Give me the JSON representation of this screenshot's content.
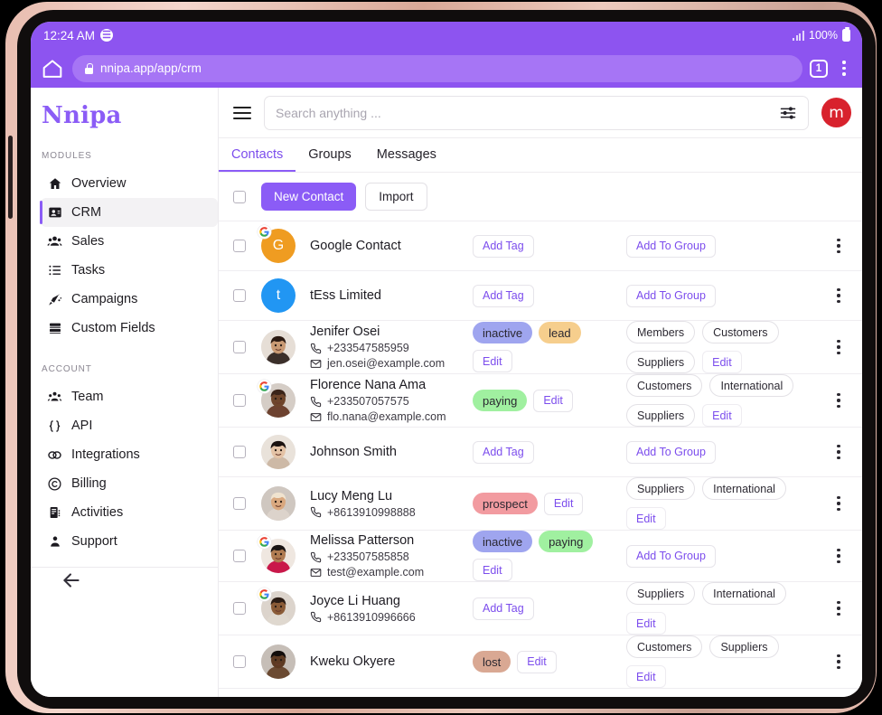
{
  "device": {
    "status_bar": {
      "time": "12:24 AM",
      "app_indicator_icon": "spotify-icon",
      "signal_icon": "signal-bars-icon",
      "battery_percent": "100%",
      "battery_icon": "battery-full-icon"
    },
    "browser": {
      "home_icon": "home-icon",
      "lock_icon": "lock-icon",
      "url": "nnipa.app/app/crm",
      "tab_count": "1",
      "menu_icon": "overflow-menu-icon"
    }
  },
  "sidebar": {
    "brand": "Nnipa",
    "sections": [
      {
        "label": "MODULES",
        "items": [
          {
            "label": "Overview",
            "icon": "home-icon",
            "active": false
          },
          {
            "label": "CRM",
            "icon": "contact-card-icon",
            "active": true
          },
          {
            "label": "Sales",
            "icon": "people-group-icon",
            "active": false
          },
          {
            "label": "Tasks",
            "icon": "task-list-icon",
            "active": false
          },
          {
            "label": "Campaigns",
            "icon": "megaphone-icon",
            "active": false
          },
          {
            "label": "Custom Fields",
            "icon": "layers-icon",
            "active": false
          }
        ]
      },
      {
        "label": "ACCOUNT",
        "items": [
          {
            "label": "Team",
            "icon": "team-icon",
            "active": false
          },
          {
            "label": "API",
            "icon": "braces-icon",
            "active": false
          },
          {
            "label": "Integrations",
            "icon": "link-icon",
            "active": false
          },
          {
            "label": "Billing",
            "icon": "coin-icon",
            "active": false
          },
          {
            "label": "Activities",
            "icon": "activity-icon",
            "active": false
          },
          {
            "label": "Support",
            "icon": "support-agent-icon",
            "active": false
          }
        ]
      }
    ],
    "back_icon": "arrow-left-icon"
  },
  "topbar": {
    "menu_icon": "hamburger-icon",
    "search_placeholder": "Search anything ...",
    "search_value": "",
    "filter_icon": "filter-sliders-icon",
    "avatar_initial": "m",
    "avatar_color": "#d8222d"
  },
  "tabs": [
    {
      "label": "Contacts",
      "active": true
    },
    {
      "label": "Groups",
      "active": false
    },
    {
      "label": "Messages",
      "active": false
    }
  ],
  "actions": {
    "new_contact_label": "New Contact",
    "import_label": "Import",
    "primary_color": "#8b5cf6"
  },
  "labels": {
    "add_tag": "Add Tag",
    "add_to_group": "Add To Group",
    "edit": "Edit"
  },
  "tag_colors": {
    "inactive": "#9fa5ef",
    "lead": "#f6ce8d",
    "paying": "#a0f0a0",
    "prospect": "#f29ba0",
    "lost": "#d9a893"
  },
  "contacts": [
    {
      "name": "Google Contact",
      "phone": "",
      "email": "",
      "avatar_type": "initial",
      "avatar_initial": "G",
      "avatar_color": "#ef9c21",
      "google_badge": true,
      "tags": [],
      "tags_placeholder": "Add Tag",
      "groups": [],
      "groups_placeholder": "Add To Group"
    },
    {
      "name": "tEss Limited",
      "phone": "",
      "email": "",
      "avatar_type": "initial",
      "avatar_initial": "t",
      "avatar_color": "#2196f3",
      "google_badge": false,
      "tags": [],
      "tags_placeholder": "Add Tag",
      "groups": [],
      "groups_placeholder": "Add To Group"
    },
    {
      "name": "Jenifer Osei",
      "phone": "+233547585959",
      "email": "jen.osei@example.com",
      "avatar_type": "photo",
      "avatar_initial": "",
      "avatar_color": "#3b2f2a",
      "google_badge": false,
      "tags": [
        "inactive",
        "lead"
      ],
      "tags_edit": "Edit",
      "groups": [
        "Members",
        "Customers",
        "Suppliers"
      ],
      "groups_edit": "Edit"
    },
    {
      "name": "Florence Nana Ama",
      "phone": "+233507057575",
      "email": "flo.nana@example.com",
      "avatar_type": "photo",
      "avatar_initial": "",
      "avatar_color": "#6d4230",
      "google_badge": true,
      "tags": [
        "paying"
      ],
      "tags_edit": "Edit",
      "groups": [
        "Customers",
        "International",
        "Suppliers"
      ],
      "groups_edit": "Edit"
    },
    {
      "name": "Johnson Smith",
      "phone": "",
      "email": "",
      "avatar_type": "photo",
      "avatar_initial": "",
      "avatar_color": "#cdb9a6",
      "google_badge": false,
      "tags": [],
      "tags_placeholder": "Add Tag",
      "groups": [],
      "groups_placeholder": "Add To Group"
    },
    {
      "name": "Lucy Meng Lu",
      "phone": "+8613910998888",
      "email": "",
      "avatar_type": "photo",
      "avatar_initial": "",
      "avatar_color": "#dcd3cb",
      "google_badge": false,
      "tags": [
        "prospect"
      ],
      "tags_edit": "Edit",
      "groups": [
        "Suppliers",
        "International"
      ],
      "groups_edit": "Edit"
    },
    {
      "name": "Melissa Patterson",
      "phone": "+233507585858",
      "email": "test@example.com",
      "avatar_type": "photo",
      "avatar_initial": "",
      "avatar_color": "#c9184a",
      "google_badge": true,
      "tags": [
        "inactive",
        "paying"
      ],
      "tags_edit": "Edit",
      "groups": [],
      "groups_placeholder": "Add To Group"
    },
    {
      "name": "Joyce Li Huang",
      "phone": "+8613910996666",
      "email": "",
      "avatar_type": "photo",
      "avatar_initial": "",
      "avatar_color": "#dfd8cf",
      "google_badge": true,
      "tags": [],
      "tags_placeholder": "Add Tag",
      "groups": [
        "Suppliers",
        "International"
      ],
      "groups_edit": "Edit"
    },
    {
      "name": "Kweku Okyere",
      "phone": "",
      "email": "",
      "avatar_type": "photo",
      "avatar_initial": "",
      "avatar_color": "#6b4a32",
      "google_badge": false,
      "tags": [
        "lost"
      ],
      "tags_edit": "Edit",
      "groups": [
        "Customers",
        "Suppliers"
      ],
      "groups_edit": "Edit"
    }
  ]
}
